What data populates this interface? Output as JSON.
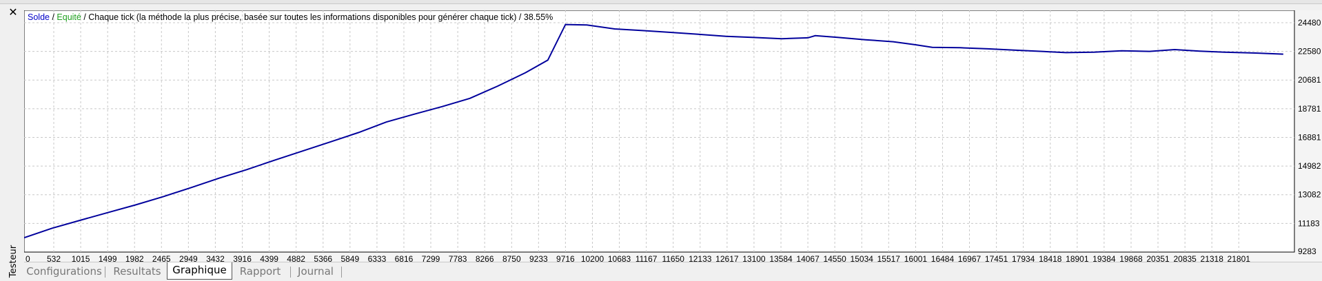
{
  "window": {
    "close_icon": "close-icon",
    "side_label": "Testeur"
  },
  "header": {
    "solde": "Solde",
    "sep1": " / ",
    "equite": "Equité",
    "rest": " / Chaque tick (la méthode la plus précise, basée sur toutes les informations disponibles pour générer chaque tick) / 38.55%",
    "solde_color": "#0000c8",
    "equite_color": "#1fa01f"
  },
  "tabs": [
    {
      "label": "Configurations",
      "active": false
    },
    {
      "label": "Resultats",
      "active": false
    },
    {
      "label": "Graphique",
      "active": true
    },
    {
      "label": "Rapport",
      "active": false
    },
    {
      "label": "Journal",
      "active": false
    }
  ],
  "chart_data": {
    "type": "line",
    "grid": true,
    "line_color": "#00009c",
    "xlim": [
      0,
      22800
    ],
    "ylim": [
      9283,
      25300
    ],
    "x_ticks": [
      0,
      532,
      1015,
      1499,
      1982,
      2465,
      2949,
      3432,
      3916,
      4399,
      4882,
      5366,
      5849,
      6333,
      6816,
      7299,
      7783,
      8266,
      8750,
      9233,
      9716,
      10200,
      10683,
      11167,
      11650,
      12133,
      12617,
      13100,
      13584,
      14067,
      14550,
      15034,
      15517,
      16001,
      16484,
      16967,
      17451,
      17934,
      18418,
      18901,
      19384,
      19868,
      20351,
      20835,
      21318,
      21801
    ],
    "y_ticks": [
      9283,
      11183,
      13082,
      14982,
      16881,
      18781,
      20681,
      22580,
      24480
    ],
    "series": [
      {
        "x": [
          0,
          500,
          1000,
          1500,
          2000,
          2500,
          3000,
          3500,
          4000,
          4500,
          5000,
          5500,
          6000,
          6500,
          7000,
          7500,
          8000,
          8500,
          9000,
          9400,
          9716,
          10100,
          10600,
          11100,
          11600,
          12100,
          12600,
          13100,
          13600,
          14067,
          14200,
          14600,
          15100,
          15600,
          16000,
          16300,
          16800,
          17300,
          17800,
          18300,
          18700,
          19200,
          19700,
          20200,
          20650,
          21100,
          21600,
          22100,
          22600
        ],
        "y": [
          10230,
          10860,
          11380,
          11900,
          12410,
          12960,
          13560,
          14180,
          14750,
          15380,
          15980,
          16590,
          17200,
          17900,
          18420,
          18920,
          19470,
          20280,
          21170,
          22000,
          24360,
          24330,
          24070,
          23960,
          23840,
          23710,
          23580,
          23500,
          23420,
          23480,
          23620,
          23510,
          23350,
          23220,
          23020,
          22850,
          22820,
          22750,
          22660,
          22570,
          22500,
          22530,
          22620,
          22580,
          22700,
          22600,
          22520,
          22470,
          22400
        ]
      }
    ]
  }
}
